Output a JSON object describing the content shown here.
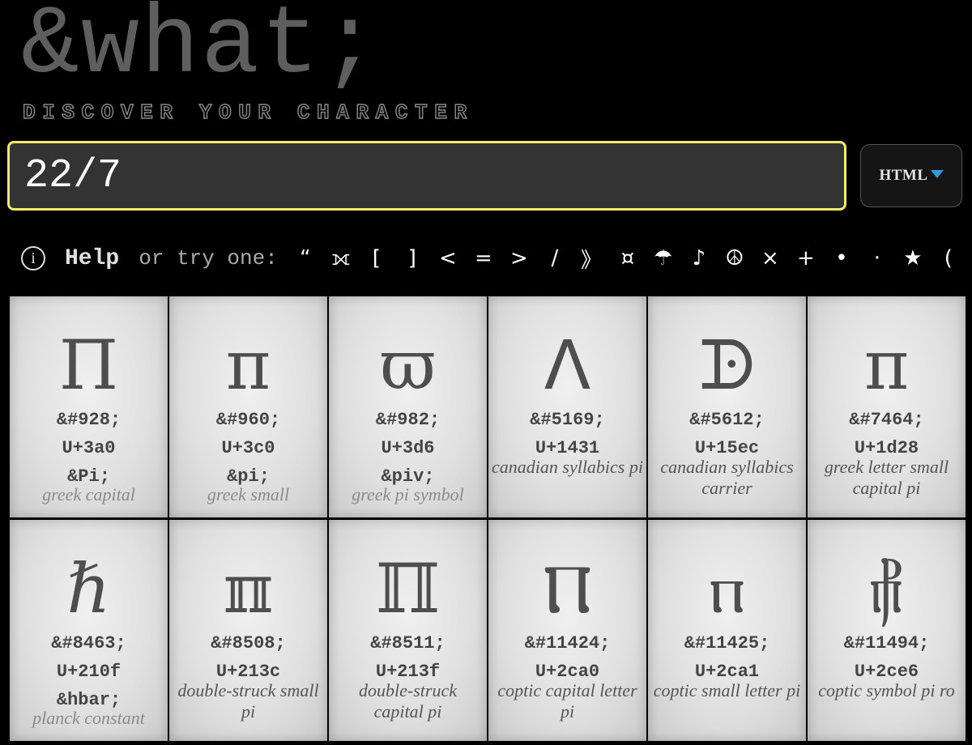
{
  "logo": {
    "text": "&what;",
    "tagline": "DISCOVER YOUR CHARACTER"
  },
  "search": {
    "value": "22/7"
  },
  "format": {
    "label": "HTML"
  },
  "help": {
    "info_glyph": "i",
    "link": "Help",
    "try_label": "or try one:",
    "suggestions": [
      "“",
      "⟗",
      "[",
      "]",
      "<",
      "=",
      ">",
      "/",
      "》",
      "¤",
      "☂",
      "♪",
      "☮",
      "×",
      "+",
      "•",
      "·",
      "★",
      "("
    ]
  },
  "cards": [
    {
      "glyph": "Π",
      "entity": "&#928;",
      "unicode": "U+3a0",
      "name": "&Pi;",
      "desc": "greek capital",
      "desc_style": "faded",
      "icon": "greek-capital-pi-glyph"
    },
    {
      "glyph": "π",
      "entity": "&#960;",
      "unicode": "U+3c0",
      "name": "&pi;",
      "desc": "greek small",
      "desc_style": "faded",
      "icon": "greek-small-pi-glyph"
    },
    {
      "glyph": "ϖ",
      "entity": "&#982;",
      "unicode": "U+3d6",
      "name": "&piv;",
      "desc": "greek pi symbol",
      "desc_style": "faded",
      "icon": "greek-pi-symbol-glyph"
    },
    {
      "glyph": "ᐱ",
      "entity": "&#5169;",
      "unicode": "U+1431",
      "name": "",
      "desc": "canadian syllabics pi",
      "desc_style": "normal",
      "icon": "canadian-syllabics-pi-glyph"
    },
    {
      "glyph": "ᗬ",
      "entity": "&#5612;",
      "unicode": "U+15ec",
      "name": "",
      "desc": "canadian syllabics carrier",
      "desc_style": "normal",
      "icon": "canadian-syllabics-carrier-pi-glyph"
    },
    {
      "glyph": "ᴨ",
      "entity": "&#7464;",
      "unicode": "U+1d28",
      "name": "",
      "desc": "greek letter small capital pi",
      "desc_style": "normal",
      "icon": "greek-small-capital-pi-glyph"
    },
    {
      "glyph": "ℏ",
      "entity": "&#8463;",
      "unicode": "U+210f",
      "name": "&hbar;",
      "desc": "planck constant",
      "desc_style": "faded",
      "icon": "planck-constant-glyph"
    },
    {
      "glyph": "ℼ",
      "entity": "&#8508;",
      "unicode": "U+213c",
      "name": "",
      "desc": "double-struck small pi",
      "desc_style": "normal",
      "icon": "double-struck-small-pi-glyph"
    },
    {
      "glyph": "ℿ",
      "entity": "&#8511;",
      "unicode": "U+213f",
      "name": "",
      "desc": "double-struck capital pi",
      "desc_style": "normal",
      "icon": "double-struck-capital-pi-glyph"
    },
    {
      "glyph": "Ⲡ",
      "entity": "&#11424;",
      "unicode": "U+2ca0",
      "name": "",
      "desc": "coptic capital letter pi",
      "desc_style": "normal",
      "icon": "coptic-capital-pi-glyph"
    },
    {
      "glyph": "ⲡ",
      "entity": "&#11425;",
      "unicode": "U+2ca1",
      "name": "",
      "desc": "coptic small letter pi",
      "desc_style": "normal",
      "icon": "coptic-small-pi-glyph"
    },
    {
      "glyph": "⳦",
      "entity": "&#11494;",
      "unicode": "U+2ce6",
      "name": "",
      "desc": "coptic symbol pi ro",
      "desc_style": "normal",
      "icon": "coptic-symbol-pi-ro-glyph"
    }
  ]
}
